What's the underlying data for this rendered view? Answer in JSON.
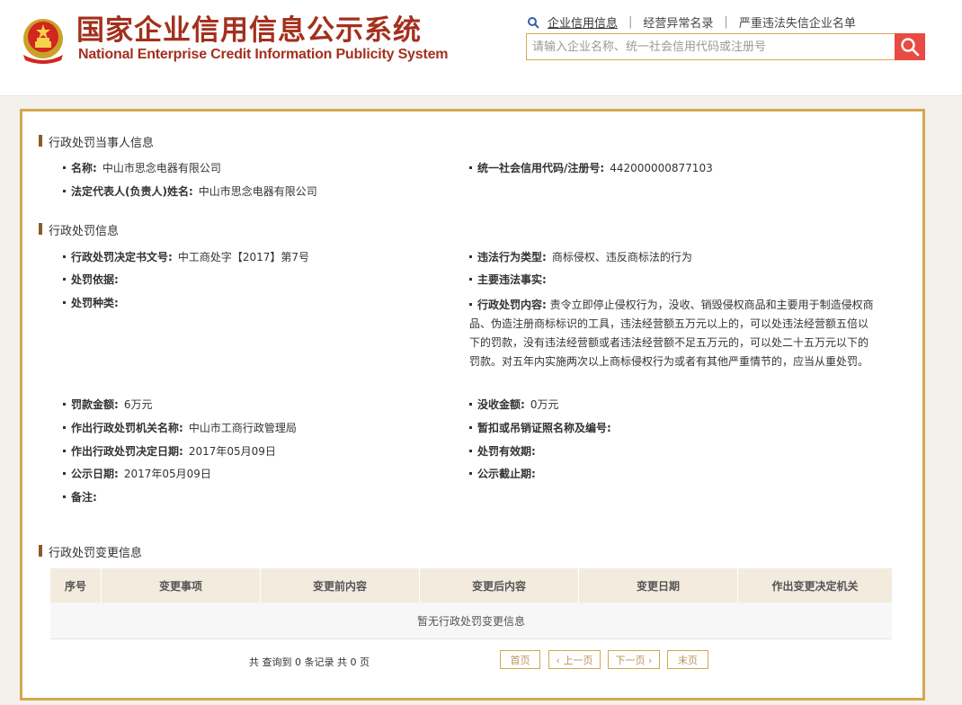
{
  "header": {
    "title_cn": "国家企业信用信息公示系统",
    "title_en": "National Enterprise Credit Information Publicity System",
    "nav": [
      "企业信用信息",
      "经营异常名录",
      "严重违法失信企业名单"
    ],
    "nav_sep": "|",
    "search_placeholder": "请输入企业名称、统一社会信用代码或注册号"
  },
  "party": {
    "section_title": "行政处罚当事人信息",
    "name_label": "名称:",
    "name_value": "中山市思念电器有限公司",
    "credit_label": "统一社会信用代码/注册号:",
    "credit_value": "442000000877103",
    "rep_label": "法定代表人(负责人)姓名:",
    "rep_value": "中山市思念电器有限公司"
  },
  "penalty": {
    "section_title": "行政处罚信息",
    "doc_no_label": "行政处罚决定书文号:",
    "doc_no_value": "中工商处字【2017】第7号",
    "violation_type_label": "违法行为类型:",
    "violation_type_value": "商标侵权、违反商标法的行为",
    "basis_label": "处罚依据:",
    "facts_label": "主要违法事实:",
    "kind_label": "处罚种类:",
    "content_label": "行政处罚内容:",
    "content_value": "责令立即停止侵权行为，没收、销毁侵权商品和主要用于制造侵权商品、伪造注册商标标识的工具，违法经营额五万元以上的，可以处违法经营额五倍以下的罚款，没有违法经营额或者违法经营额不足五万元的，可以处二十五万元以下的罚款。对五年内实施两次以上商标侵权行为或者有其他严重情节的，应当从重处罚。",
    "fine_label": "罚款金额:",
    "fine_value": "6万元",
    "confiscate_label": "没收金额:",
    "confiscate_value": "0万元",
    "authority_label": "作出行政处罚机关名称:",
    "authority_value": "中山市工商行政管理局",
    "license_label": "暂扣或吊销证照名称及编号:",
    "decision_date_label": "作出行政处罚决定日期:",
    "decision_date_value": "2017年05月09日",
    "validity_label": "处罚有效期:",
    "publicity_date_label": "公示日期:",
    "publicity_date_value": "2017年05月09日",
    "publicity_end_label": "公示截止期:",
    "remark_label": "备注:"
  },
  "changes": {
    "section_title": "行政处罚变更信息",
    "columns": [
      "序号",
      "变更事项",
      "变更前内容",
      "变更后内容",
      "变更日期",
      "作出变更决定机关"
    ],
    "empty_text": "暂无行政处罚变更信息"
  },
  "pager": {
    "info": "共 查询到 0 条记录 共 0 页",
    "first": "首页",
    "prev": "‹ 上一页",
    "next": "下一页 ›",
    "last": "末页"
  },
  "colors": {
    "brand_red": "#a3301e",
    "gold_border": "#d3a84f",
    "search_button": "#e84b42"
  }
}
